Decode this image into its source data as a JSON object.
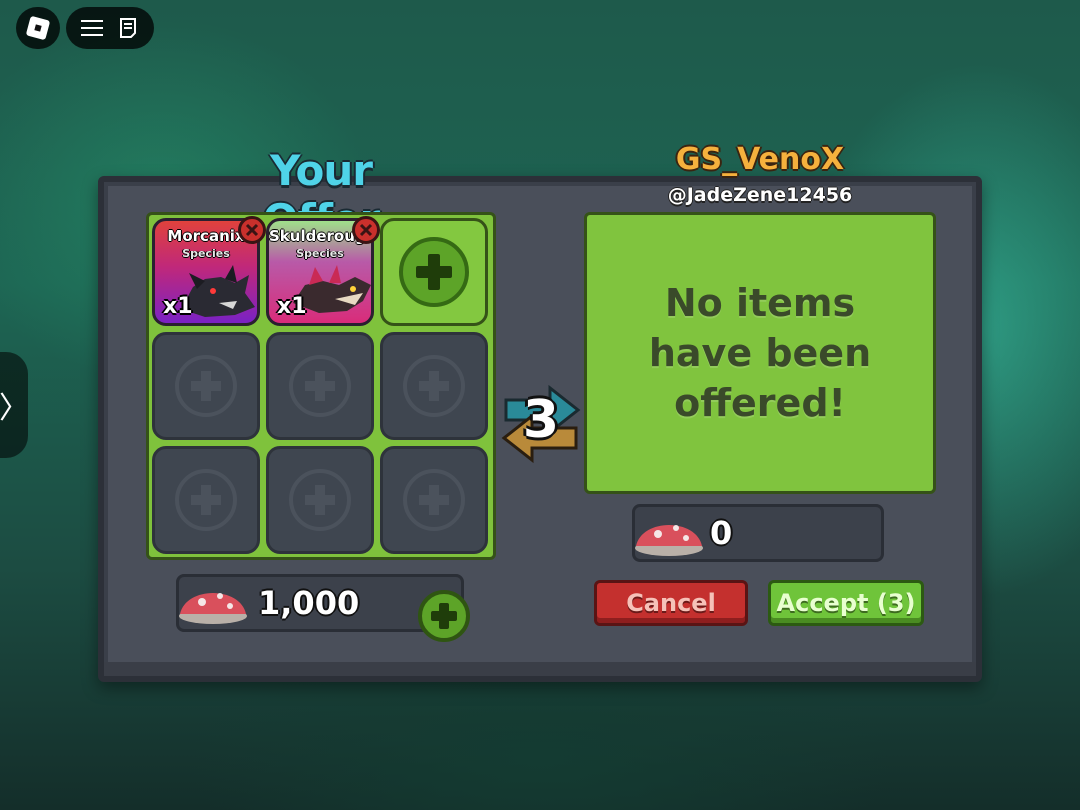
{
  "roblox_bar": {
    "logo_icon": "roblox-logo-icon",
    "menu_icon": "hamburger-menu-icon",
    "chat_icon": "chat-icon",
    "side_tab_glyph": "〉"
  },
  "trade": {
    "your_offer_title": "Your Offer",
    "partner_display_name": "GS_VenoX",
    "partner_username": "@JadeZene12456",
    "countdown": "3",
    "your_items": [
      {
        "name": "Morcanix",
        "type": "Species",
        "quantity": "x1",
        "color": "#7a22c4"
      },
      {
        "name": "Skulderougue",
        "type": "Species",
        "quantity": "x1",
        "color": "#d92c7a"
      }
    ],
    "empty_slots": 6,
    "your_currency": "1,000",
    "partner_currency": "0",
    "currency_icon": "red-mushroom-icon",
    "partner_empty_message": "No items have been offered!",
    "cancel_label": "Cancel",
    "accept_label": "Accept (3)"
  },
  "colors": {
    "grid_green": "#7fc23c",
    "title_cyan": "#4fd3e8",
    "partner_gold": "#f5b13d",
    "cancel_red": "#c4302e",
    "accept_green": "#6fc43a",
    "panel_gray": "#4a4f5a"
  }
}
